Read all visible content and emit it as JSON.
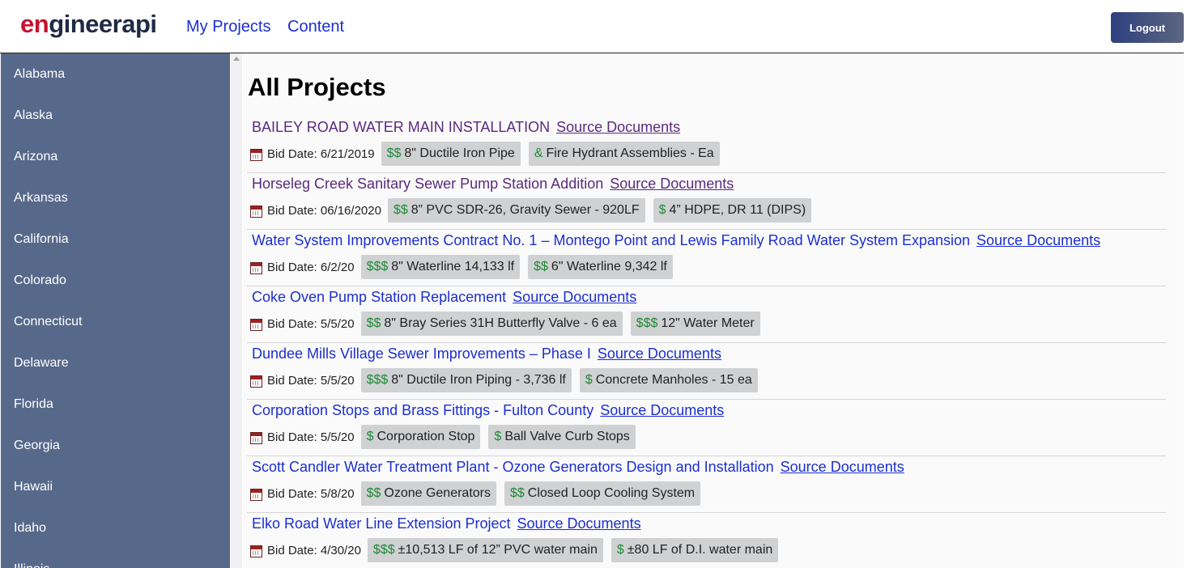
{
  "header": {
    "logo_part1": "en",
    "logo_part2": "gineerapi",
    "nav": [
      "My Projects",
      "Content"
    ],
    "logout_label": "Logout"
  },
  "sidebar": {
    "items": [
      "Alabama",
      "Alaska",
      "Arizona",
      "Arkansas",
      "California",
      "Colorado",
      "Connecticut",
      "Delaware",
      "Florida",
      "Georgia",
      "Hawaii",
      "Idaho",
      "Illinois"
    ]
  },
  "main": {
    "title": "All Projects",
    "source_label": "Source Documents",
    "projects": [
      {
        "title": "BAILEY ROAD WATER MAIN INSTALLATION",
        "visited": true,
        "bid": "Bid Date: 6/21/2019",
        "tags": [
          {
            "d": "$$",
            "t": "8\" Ductile Iron Pipe"
          },
          {
            "d": "&",
            "t": "Fire Hydrant Assemblies - Ea"
          }
        ]
      },
      {
        "title": "Horseleg Creek Sanitary Sewer Pump Station Addition",
        "visited": true,
        "bid": "Bid Date: 06/16/2020",
        "tags": [
          {
            "d": "$$",
            "t": "8” PVC SDR-26, Gravity Sewer - 920LF"
          },
          {
            "d": "$",
            "t": "4” HDPE, DR 11 (DIPS)"
          }
        ]
      },
      {
        "title": "Water System Improvements Contract No. 1 – Montego Point and Lewis Family Road Water System Expansion",
        "visited": false,
        "bid": "Bid Date: 6/2/20",
        "tags": [
          {
            "d": "$$$",
            "t": "8\" Waterline 14,133 lf"
          },
          {
            "d": "$$",
            "t": "6\" Waterline 9,342 lf"
          }
        ]
      },
      {
        "title": "Coke Oven Pump Station Replacement",
        "visited": false,
        "bid": "Bid Date: 5/5/20",
        "tags": [
          {
            "d": "$$",
            "t": "8\" Bray Series 31H Butterfly Valve - 6 ea"
          },
          {
            "d": "$$$",
            "t": "12\" Water Meter"
          }
        ]
      },
      {
        "title": "Dundee Mills Village Sewer Improvements – Phase I",
        "visited": false,
        "bid": "Bid Date: 5/5/20",
        "tags": [
          {
            "d": "$$$",
            "t": "8\" Ductile Iron Piping - 3,736 lf"
          },
          {
            "d": "$",
            "t": "Concrete Manholes - 15 ea"
          }
        ]
      },
      {
        "title": "Corporation Stops and Brass Fittings - Fulton County",
        "visited": false,
        "bid": "Bid Date: 5/5/20",
        "tags": [
          {
            "d": "$",
            "t": "Corporation Stop"
          },
          {
            "d": "$",
            "t": "Ball Valve Curb Stops"
          }
        ]
      },
      {
        "title": "Scott Candler Water Treatment Plant - Ozone Generators Design and Installation",
        "visited": false,
        "bid": "Bid Date: 5/8/20",
        "tags": [
          {
            "d": "$$",
            "t": "Ozone Generators"
          },
          {
            "d": "$$",
            "t": "Closed Loop Cooling System"
          }
        ]
      },
      {
        "title": "Elko Road Water Line Extension Project",
        "visited": false,
        "bid": "Bid Date: 4/30/20",
        "tags": [
          {
            "d": "$$$",
            "t": "±10,513 LF of 12” PVC water main"
          },
          {
            "d": "$",
            "t": "±80 LF of D.I. water main"
          }
        ]
      }
    ]
  }
}
